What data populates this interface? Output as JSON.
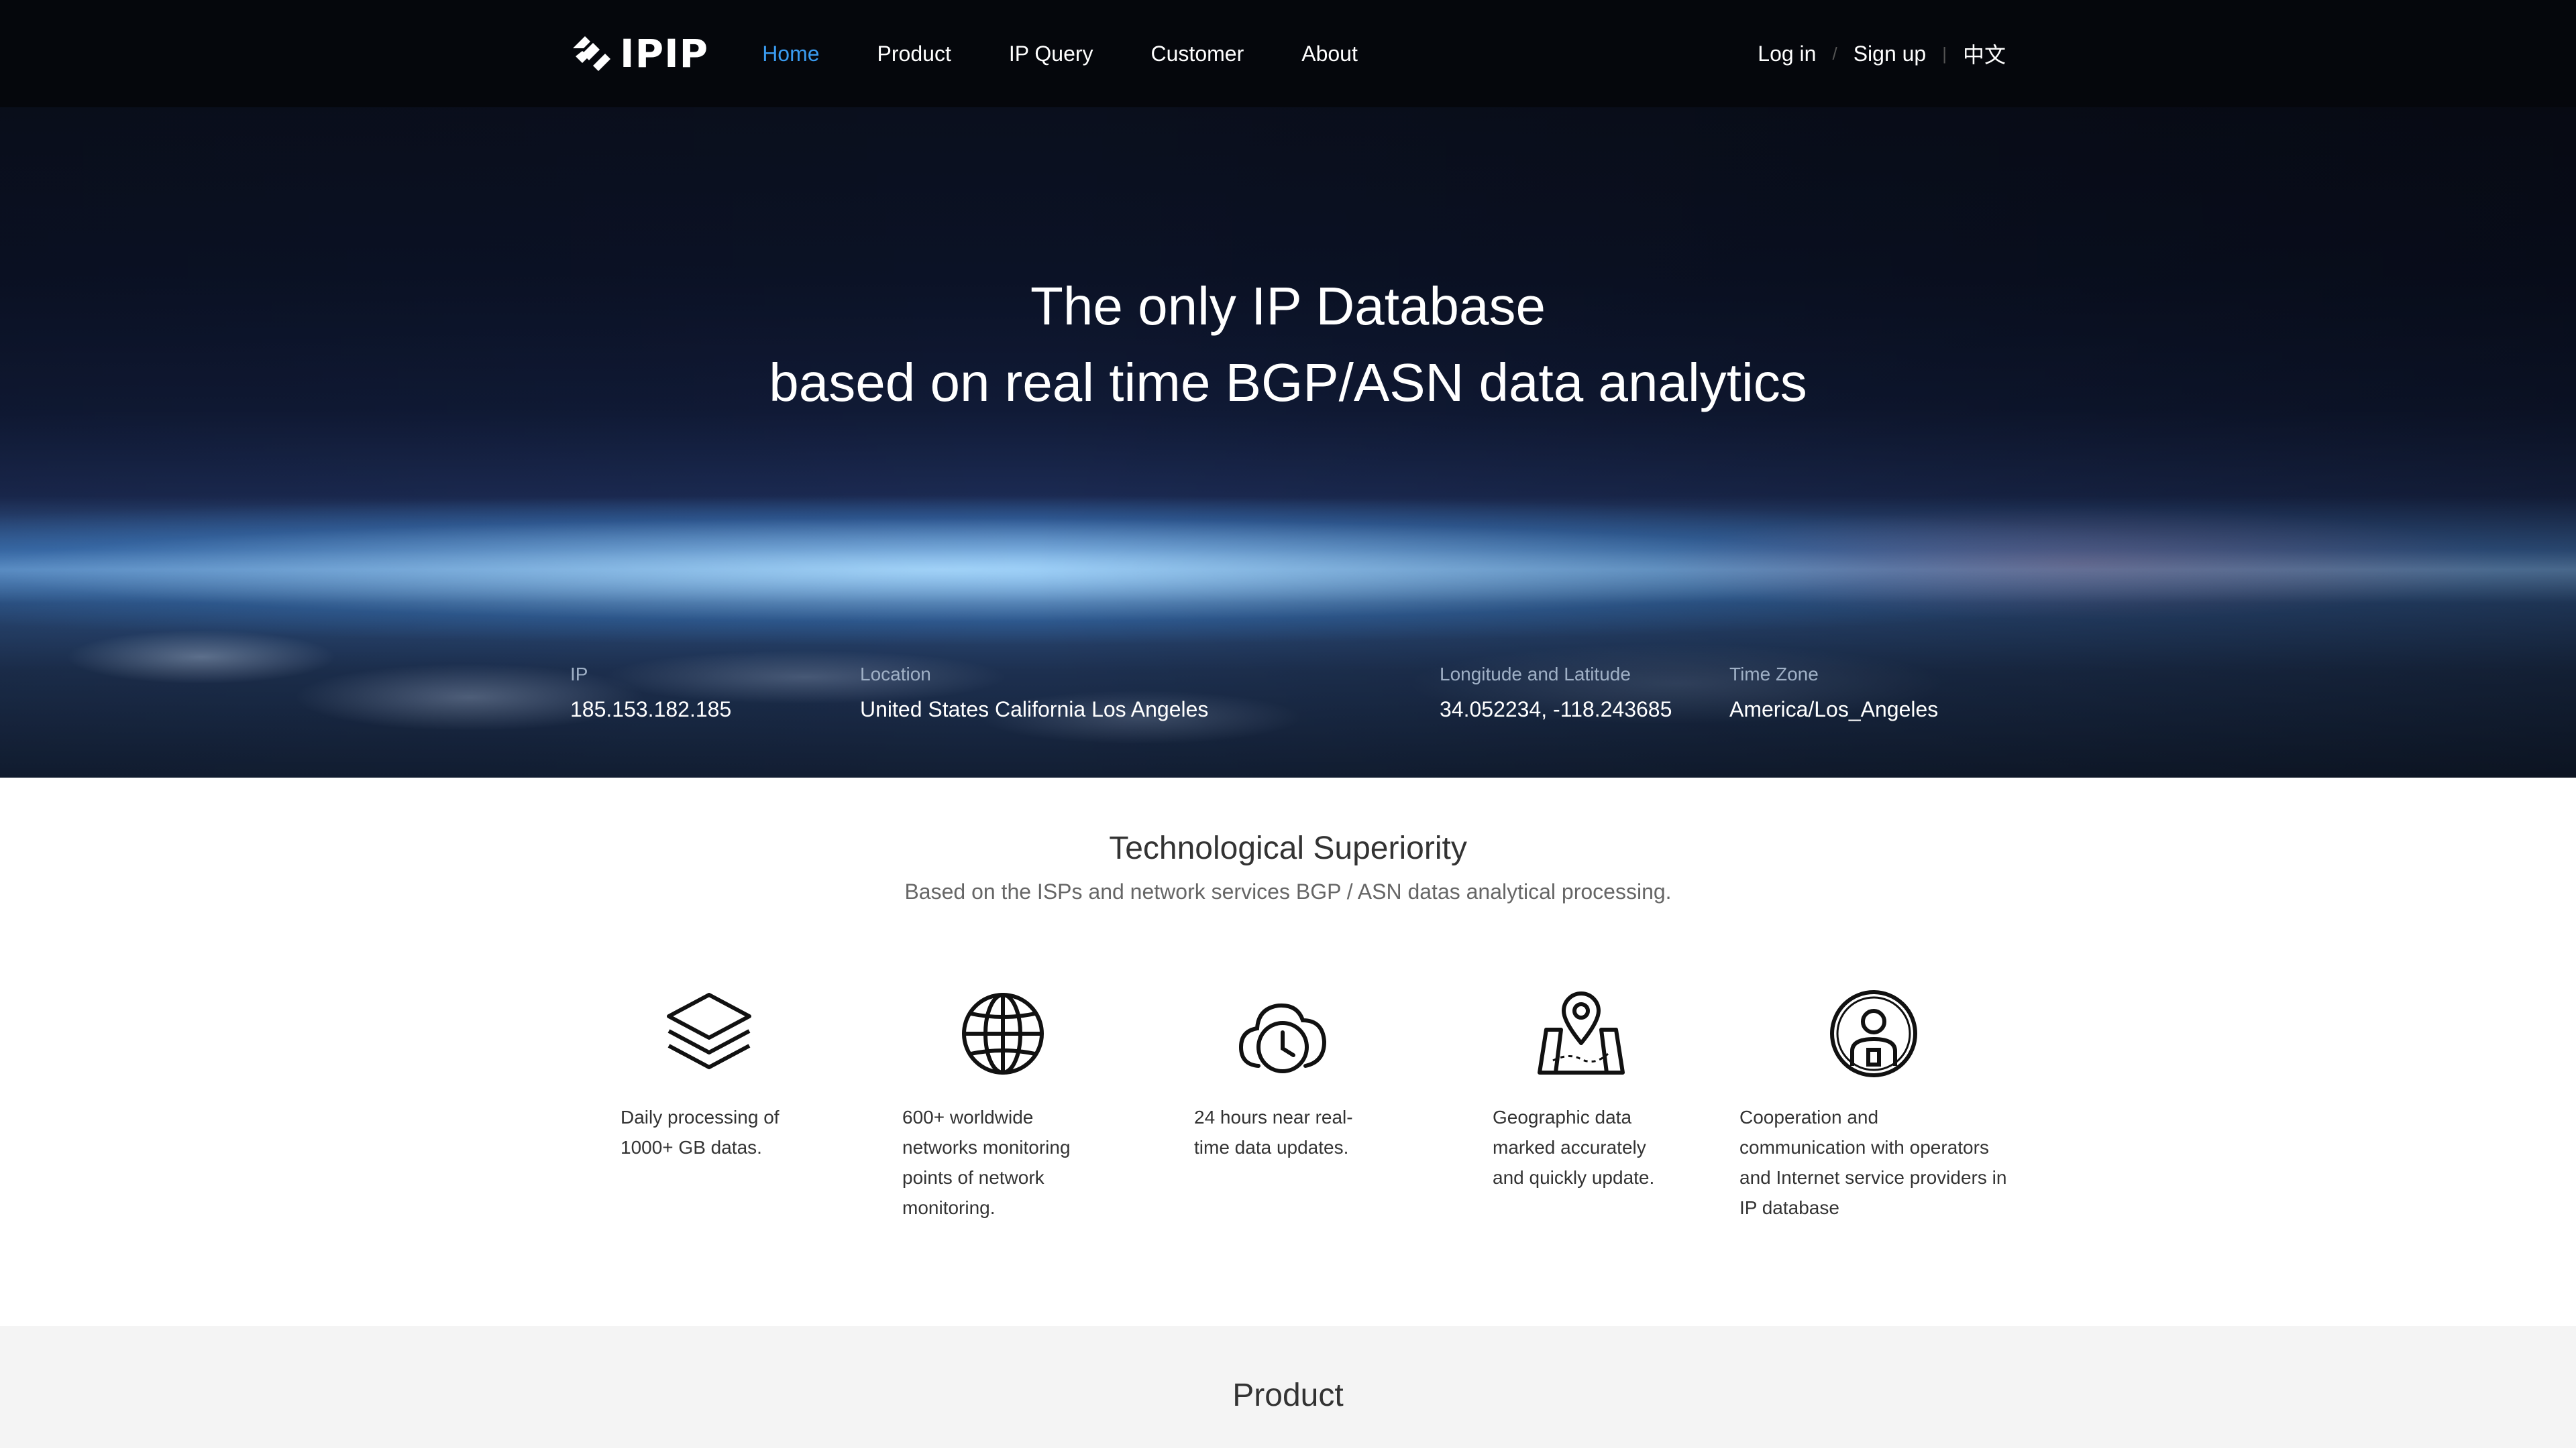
{
  "nav": {
    "logo_text": "IPIP",
    "links": [
      {
        "label": "Home",
        "active": true
      },
      {
        "label": "Product",
        "active": false
      },
      {
        "label": "IP Query",
        "active": false
      },
      {
        "label": "Customer",
        "active": false
      },
      {
        "label": "About",
        "active": false
      }
    ],
    "login": "Log in",
    "divider": "/",
    "signup": "Sign up",
    "divider2": "|",
    "language": "中文",
    "active_color": "#3a9bf0"
  },
  "hero": {
    "line1": "The only IP Database",
    "line2": "based on real time BGP/ASN data analytics"
  },
  "ipinfo": {
    "ip_label": "IP",
    "ip_value": "185.153.182.185",
    "location_label": "Location",
    "location_value": "United States California Los Angeles",
    "lonlat_label": "Longitude and Latitude",
    "lonlat_value": "34.052234, -118.243685",
    "tz_label": "Time Zone",
    "tz_value": "America/Los_Angeles"
  },
  "tech": {
    "title": "Technological Superiority",
    "subtitle": "Based on the ISPs and network services BGP / ASN datas analytical processing.",
    "features": [
      {
        "icon": "layers-icon",
        "text": "Daily processing of 1000+ GB datas."
      },
      {
        "icon": "globe-icon",
        "text": "600+ worldwide networks monitoring points of network monitoring."
      },
      {
        "icon": "cloud-clock-icon",
        "text": "24 hours near real-time data updates."
      },
      {
        "icon": "map-pin-icon",
        "text": "Geographic data marked accurately and quickly update."
      },
      {
        "icon": "person-circle-icon",
        "text": "Cooperation and communication with operators and Internet service providers in IP database"
      }
    ]
  },
  "product": {
    "title": "Product"
  }
}
